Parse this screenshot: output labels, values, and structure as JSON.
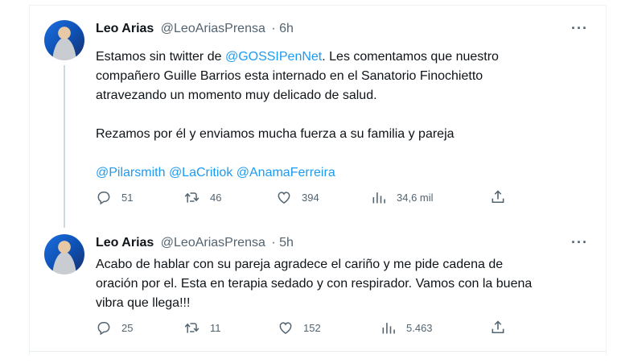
{
  "tweets": [
    {
      "author_name": "Leo Arias",
      "handle": "@LeoAriasPrensa",
      "time": "· 6h",
      "more": "···",
      "text_1_pre": "Estamos sin twitter de ",
      "text_1_mention": "@GOSSIPenNet",
      "text_1_post": ".  Les comentamos que nuestro",
      "text_2": "compañero Guille Barrios esta internado en el Sanatorio Finochietto",
      "text_3": "atravezando un momento muy delicado de salud.",
      "text_4": "Rezamos por él y enviamos mucha fuerza a su familia y pareja",
      "mentions": [
        "@Pilarsmith",
        "@LaCritiok",
        "@AnamaFerreira"
      ],
      "replies": "51",
      "retweets": "46",
      "likes": "394",
      "views": "34,6 mil"
    },
    {
      "author_name": "Leo Arias",
      "handle": "@LeoAriasPrensa",
      "time": "· 5h",
      "more": "···",
      "text_1": "Acabo de hablar con su pareja agradece el cariño y me pide cadena de",
      "text_2": "oración por el. Esta en terapia sedado y con respirador. Vamos con la buena",
      "text_3": "vibra que llega!!!",
      "replies": "25",
      "retweets": "11",
      "likes": "152",
      "views": "5.463"
    }
  ],
  "icons": {
    "reply": "reply-icon",
    "retweet": "retweet-icon",
    "like": "heart-icon",
    "views": "analytics-icon",
    "share": "share-icon"
  },
  "colors": {
    "link": "#1d9bf0",
    "secondary": "#536471",
    "text": "#0f1419"
  }
}
